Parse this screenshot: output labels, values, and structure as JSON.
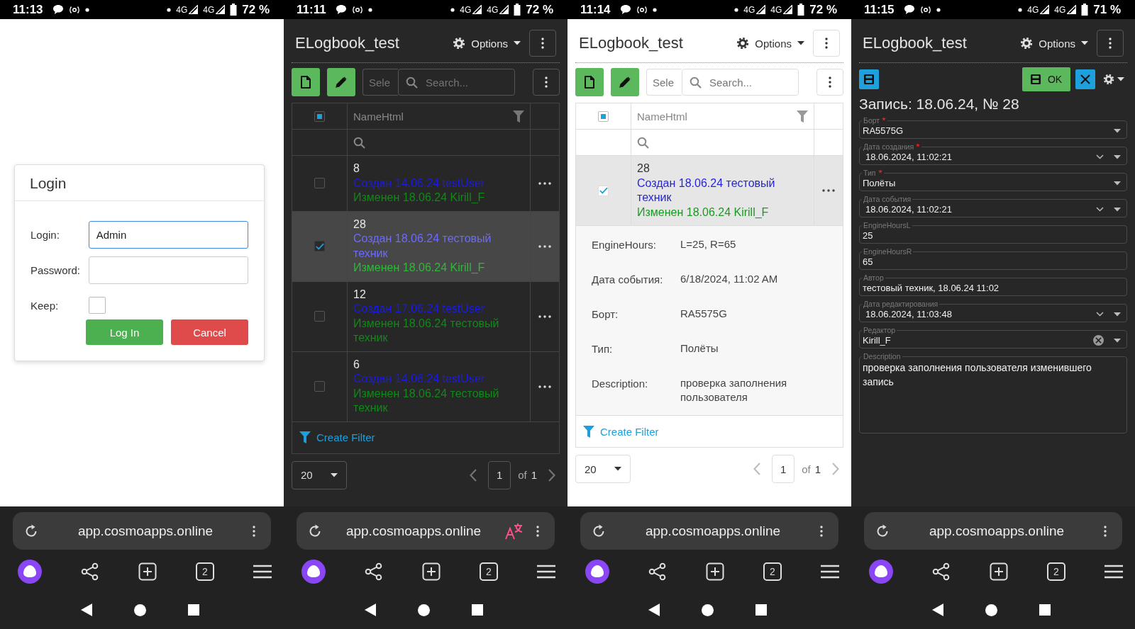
{
  "screens": [
    {
      "kind": "login",
      "dark": false,
      "status_bar": {
        "time": "11:13",
        "network_1": "4G",
        "network_2": "4G",
        "battery": "72 %"
      },
      "dialog": {
        "title": "Login",
        "fields": [
          {
            "label": "Login:",
            "kind": "text",
            "value": "Admin",
            "focused": true
          },
          {
            "label": "Password:",
            "kind": "password",
            "focused": false
          },
          {
            "label": "Keep:",
            "kind": "checkbox",
            "checked": false
          }
        ],
        "buttons": [
          {
            "label": "Log In",
            "kind": "primary"
          },
          {
            "label": "Cancel",
            "kind": "danger"
          }
        ]
      },
      "browser": {
        "url": "app.cosmoapps.online",
        "translate": false,
        "tab_count": "2"
      }
    },
    {
      "kind": "grid",
      "dark": true,
      "status_bar": {
        "time": "11:11",
        "network_1": "4G",
        "network_2": "4G",
        "battery": "72 %"
      },
      "header": {
        "title": "ELogbook_test",
        "options": "Options"
      },
      "toolbar": {
        "select_placeholder": "Sele",
        "search_placeholder": "Search..."
      },
      "table": {
        "column": "NameHtml",
        "indeterminate": true,
        "rows": [
          {
            "id": "8",
            "created": "Создан 14.06.24 testUser",
            "modified": "Изменен 18.06.24 Kirill_F",
            "selected": false
          },
          {
            "id": "28",
            "created": "Создан 18.06.24 тестовый техник",
            "modified": "Изменен 18.06.24 Kirill_F",
            "selected": true
          },
          {
            "id": "12",
            "created": "Создан 17.06.24 testUser",
            "modified": "Изменен 18.06.24 тестовый техник",
            "selected": false
          },
          {
            "id": "6",
            "created": "Создан 14.06.24 testUser",
            "modified": "Изменен 18.06.24 тестовый техник",
            "selected": false
          }
        ],
        "footer": "Create Filter"
      },
      "pager": {
        "page_size": "20",
        "page": "1",
        "of": "of",
        "pages": "1"
      },
      "browser": {
        "url": "app.cosmoapps.online",
        "translate": true,
        "tab_count": "2"
      }
    },
    {
      "kind": "grid",
      "dark": false,
      "status_bar": {
        "time": "11:14",
        "network_1": "4G",
        "network_2": "4G",
        "battery": "72 %"
      },
      "header": {
        "title": "ELogbook_test",
        "options": "Options"
      },
      "toolbar": {
        "select_placeholder": "Sele",
        "search_placeholder": "Search..."
      },
      "table": {
        "column": "NameHtml",
        "indeterminate": true,
        "rows": [
          {
            "id": "28",
            "created": "Создан 18.06.24 тестовый техник",
            "modified": "Изменен 18.06.24 Kirill_F",
            "selected": true,
            "details": [
              {
                "label": "EngineHours:",
                "value": "L=25, R=65"
              },
              {
                "label": "Дата события:",
                "value": "6/18/2024, 11:02 AM"
              },
              {
                "label": "Борт:",
                "value": "RA5575G"
              },
              {
                "label": "Тип:",
                "value": "Полёты"
              },
              {
                "label": "Description:",
                "value": "проверка заполнения пользователя"
              }
            ]
          }
        ],
        "footer": "Create Filter"
      },
      "pager": {
        "page_size": "20",
        "page": "1",
        "of": "of",
        "pages": "1"
      },
      "browser": {
        "url": "app.cosmoapps.online",
        "translate": false,
        "tab_count": "2"
      }
    },
    {
      "kind": "form",
      "dark": true,
      "status_bar": {
        "time": "11:15",
        "network_1": "4G",
        "network_2": "4G",
        "battery": "71 %"
      },
      "header": {
        "title": "ELogbook_test",
        "options": "Options"
      },
      "form": {
        "ok": "OK",
        "title": "Запись: 18.06.24, № 28",
        "fields": [
          {
            "label": "Борт",
            "required": true,
            "kind": "select",
            "value": "RA5575G"
          },
          {
            "label": "Дата создания",
            "required": true,
            "kind": "date",
            "value": "18.06.2024, 11:02:21"
          },
          {
            "label": "Тип",
            "required": true,
            "kind": "select",
            "value": "Полёты"
          },
          {
            "label": "Дата события",
            "required": false,
            "kind": "date",
            "value": "18.06.2024, 11:02:21"
          },
          {
            "label": "EngineHoursL",
            "required": false,
            "kind": "text",
            "value": "25"
          },
          {
            "label": "EngineHoursR",
            "required": false,
            "kind": "text",
            "value": "65"
          },
          {
            "label": "Автор",
            "required": false,
            "kind": "text",
            "value": "тестовый техник, 18.06.24 11:02"
          },
          {
            "label": "Дата редактирования",
            "required": false,
            "kind": "date",
            "value": "18.06.2024, 11:03:48"
          },
          {
            "label": "Редактор",
            "required": false,
            "kind": "clearable",
            "value": "Kirill_F"
          },
          {
            "label": "Description",
            "required": false,
            "kind": "textarea",
            "value": "проверка заполнения пользователя изменившего запись"
          }
        ]
      },
      "browser": {
        "url": "app.cosmoapps.online",
        "translate": false,
        "tab_count": "2"
      }
    }
  ]
}
